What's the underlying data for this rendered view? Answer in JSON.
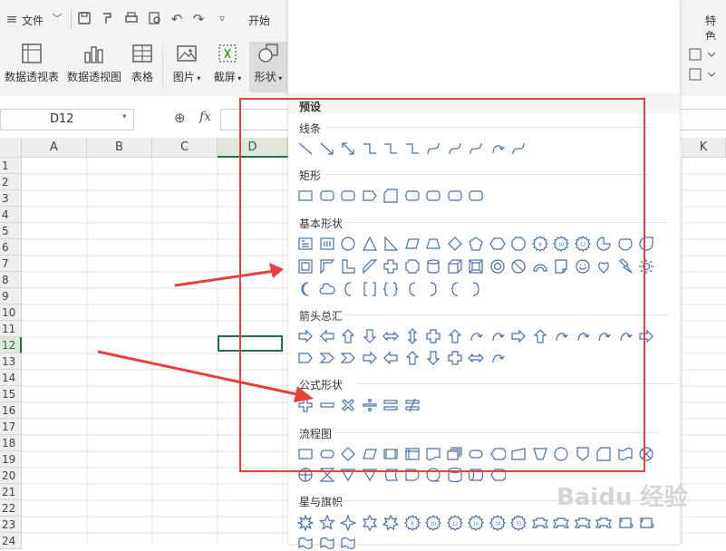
{
  "menubar": {
    "file_label": "文件",
    "start_label": "开始",
    "right_label": "特色"
  },
  "ribbon": {
    "buttons": [
      {
        "label": "数据透视表"
      },
      {
        "label": "数据透视图"
      },
      {
        "label": "表格"
      },
      {
        "label": "图片"
      },
      {
        "label": "截屏"
      },
      {
        "label": "形状"
      }
    ]
  },
  "formula_bar": {
    "cell_ref": "D12",
    "fx_label": "fx"
  },
  "sheet": {
    "columns": [
      "A",
      "B",
      "C",
      "D",
      "K"
    ],
    "rows": [
      "1",
      "2",
      "3",
      "4",
      "5",
      "6",
      "7",
      "8",
      "9",
      "10",
      "11",
      "12",
      "13",
      "14",
      "15",
      "16",
      "17",
      "18",
      "19",
      "20",
      "21",
      "22",
      "23",
      "24"
    ],
    "active_cell": "D12"
  },
  "shapes_panel": {
    "preset_label": "预设",
    "sections": [
      {
        "title": "线条"
      },
      {
        "title": "矩形"
      },
      {
        "title": "基本形状"
      },
      {
        "title": "箭头总汇"
      },
      {
        "title": "公式形状"
      },
      {
        "title": "流程图"
      },
      {
        "title": "星与旗帜"
      }
    ]
  },
  "colors": {
    "accent_green": "#217346",
    "highlight_red": "#e8413b",
    "shape_blue": "#4a6fa5"
  },
  "watermark": "Baidu 经验"
}
